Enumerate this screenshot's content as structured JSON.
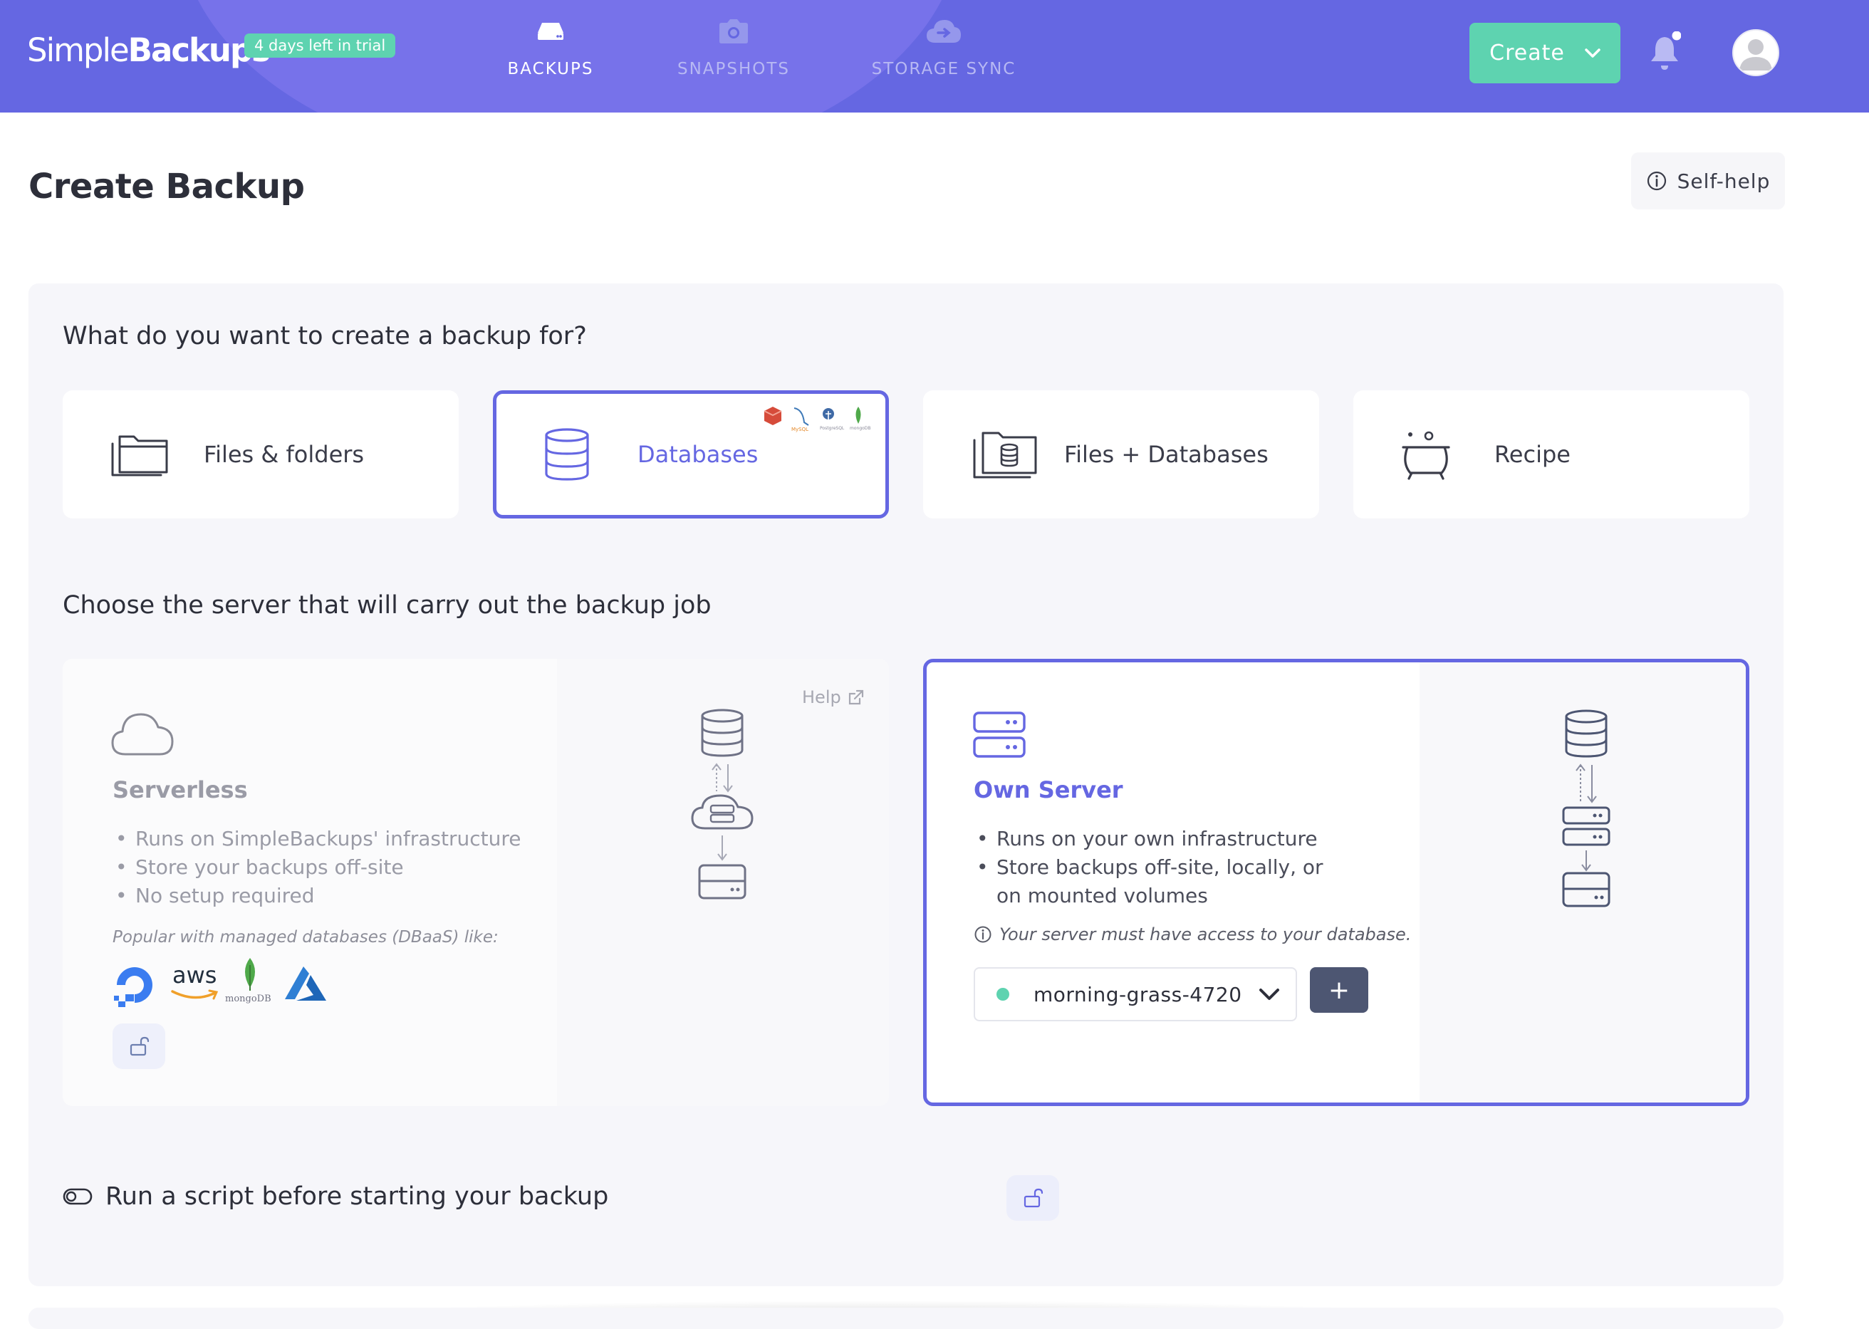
{
  "header": {
    "logo_light": "Simple",
    "logo_bold": "Backups",
    "trial_badge": "4 days left in trial",
    "nav": [
      {
        "label": "BACKUPS",
        "icon": "hard-drive-icon",
        "active": true
      },
      {
        "label": "SNAPSHOTS",
        "icon": "camera-icon",
        "active": false
      },
      {
        "label": "STORAGE SYNC",
        "icon": "cloud-sync-icon",
        "active": false
      }
    ],
    "create_label": "Create",
    "notifications_icon": "bell-icon"
  },
  "page": {
    "title": "Create Backup",
    "self_help_label": "Self-help"
  },
  "backup_type": {
    "heading": "What do you want to create a backup for?",
    "options": [
      {
        "label": "Files & folders",
        "icon": "folder-icon",
        "selected": false
      },
      {
        "label": "Databases",
        "icon": "database-icon",
        "selected": true
      },
      {
        "label": "Files + Databases",
        "icon": "folder-database-icon",
        "selected": false
      },
      {
        "label": "Recipe",
        "icon": "cauldron-icon",
        "selected": false
      }
    ]
  },
  "server": {
    "heading": "Choose the server that will carry out the backup job",
    "serverless": {
      "title": "Serverless",
      "bullets": [
        "Runs on SimpleBackups' infrastructure",
        "Store your backups off-site",
        "No setup required"
      ],
      "popular_label": "Popular with managed databases (DBaaS) like:",
      "providers": [
        "digitalocean-logo",
        "aws",
        "mongoDB",
        "azure-logo"
      ],
      "help_label": "Help",
      "selected": false
    },
    "own": {
      "title": "Own Server",
      "bullets": [
        "Runs on your own infrastructure",
        "Store backups off-site, locally, or on mounted volumes"
      ],
      "note": "Your server must have access to your database.",
      "selected_server": "morning-grass-4720",
      "add_label": "+",
      "selected": true
    }
  },
  "script_toggle": {
    "label": "Run a script before starting your backup",
    "enabled": false
  },
  "colors": {
    "brand": "#6567e2",
    "accent": "#5ed3b0",
    "panel": "#f6f6fa",
    "dark_button": "#4d5672"
  }
}
